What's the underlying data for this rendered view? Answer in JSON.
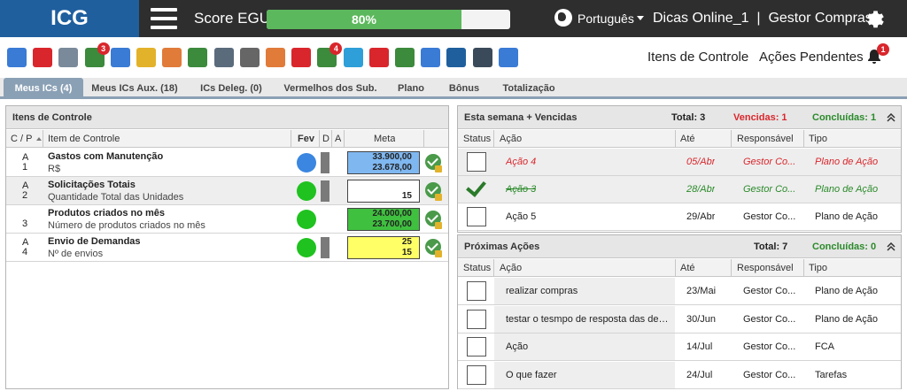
{
  "app": {
    "logo": "ICG",
    "score_label": "Score EGU:",
    "score_value": "80%",
    "score_fraction": 0.8,
    "language": "Português",
    "user": "Dicas Online_1  |  Gestor Compras"
  },
  "toolbar": {
    "icons": [
      {
        "name": "edit-icon",
        "color": "#3a7bd5"
      },
      {
        "name": "target-icon",
        "color": "#d9262c"
      },
      {
        "name": "checklist-icon",
        "color": "#7a8a9a"
      },
      {
        "name": "list-icon",
        "color": "#3c8a3c",
        "badge": "3"
      },
      {
        "name": "chart-down-icon",
        "color": "#3a7bd5"
      },
      {
        "name": "attachment-icon",
        "color": "#e3b22b"
      },
      {
        "name": "team-icon",
        "color": "#e07b39"
      },
      {
        "name": "award-icon",
        "color": "#3c8a3c"
      },
      {
        "name": "calendar-icon",
        "color": "#5a6b7c"
      },
      {
        "name": "stopwatch-icon",
        "color": "#666666"
      },
      {
        "name": "blocks-icon",
        "color": "#e07b39"
      },
      {
        "name": "crosshair-icon",
        "color": "#d9262c"
      },
      {
        "name": "approve-icon",
        "color": "#3c8a3c",
        "badge": "4"
      },
      {
        "name": "puzzle-icon",
        "color": "#2e9fd8"
      },
      {
        "name": "pdf-icon",
        "color": "#d9262c"
      },
      {
        "name": "alert-off-icon",
        "color": "#3c8a3c"
      },
      {
        "name": "presentation-icon",
        "color": "#3a7bd5"
      },
      {
        "name": "grid-icon",
        "color": "#1f5f9e"
      },
      {
        "name": "help-icon",
        "color": "#3a4a5a"
      },
      {
        "name": "rocket-icon",
        "color": "#3a7bd5"
      }
    ],
    "itens_label": "Itens de Controle",
    "acoes_label": "Ações Pendentes",
    "bell_badge": "1"
  },
  "tabs": [
    "Meus ICs (4)",
    "Meus ICs Aux. (18)",
    "ICs Deleg. (0)",
    "Vermelhos dos Sub.",
    "Plano",
    "Bônus",
    "Totalização"
  ],
  "left": {
    "title": "Itens de Controle",
    "headers": {
      "cp": "C / P",
      "item": "Item de Controle",
      "fev": "Fev",
      "d": "D",
      "a": "A",
      "meta": "Meta"
    },
    "rows": [
      {
        "c": "A",
        "p": "1",
        "name": "Gastos com Manutenção",
        "unit": "R$",
        "status": "blue",
        "meta": [
          "33.900,00",
          "23.678,00"
        ],
        "meta_color": "#7fb7f0"
      },
      {
        "c": "A",
        "p": "2",
        "name": "Solicitações Totais",
        "unit": "Quantidade Total das Unidades",
        "status": "green",
        "meta": [
          "",
          "15"
        ],
        "meta_color": "#ffffff"
      },
      {
        "c": "",
        "p": "3",
        "name": "Produtos criados no mês",
        "unit": "Número de produtos criados no mês",
        "status": "green",
        "meta": [
          "24.000,00",
          "23.700,00"
        ],
        "meta_color": "#3fc03f"
      },
      {
        "c": "A",
        "p": "4",
        "name": "Envio de Demandas",
        "unit": "Nº de envios",
        "status": "green",
        "meta": [
          "25",
          "15"
        ],
        "meta_color": "#ffff66"
      }
    ]
  },
  "right_top": {
    "title": "Esta semana + Vencidas",
    "total": "Total: 3",
    "vencidas": "Vencidas: 1",
    "concluidas": "Concluídas: 1",
    "headers": {
      "status": "Status",
      "acao": "Ação",
      "ate": "Até",
      "resp": "Responsável",
      "tipo": "Tipo"
    },
    "rows": [
      {
        "acao": "Ação 4",
        "ate": "05/Abr",
        "resp": "Gestor Co...",
        "tipo": "Plano de Ação",
        "state": "overdue"
      },
      {
        "acao": "Ação 3",
        "ate": "28/Abr",
        "resp": "Gestor Co...",
        "tipo": "Plano de Ação",
        "state": "done"
      },
      {
        "acao": "Ação 5",
        "ate": "29/Abr",
        "resp": "Gestor Co...",
        "tipo": "Plano de Ação",
        "state": "open"
      }
    ]
  },
  "right_bottom": {
    "title": "Próximas Ações",
    "total": "Total: 7",
    "concluidas": "Concluídas: 0",
    "headers": {
      "status": "Status",
      "acao": "Ação",
      "ate": "Até",
      "resp": "Responsável",
      "tipo": "Tipo"
    },
    "rows": [
      {
        "acao": "realizar compras",
        "ate": "23/Mai",
        "resp": "Gestor Co...",
        "tipo": "Plano de Ação"
      },
      {
        "acao": "testar o tesmpo de resposta das dema...",
        "ate": "30/Jun",
        "resp": "Gestor Co...",
        "tipo": "Plano de Ação"
      },
      {
        "acao": "Ação",
        "ate": "14/Jul",
        "resp": "Gestor Co...",
        "tipo": "FCA"
      },
      {
        "acao": "O que fazer",
        "ate": "24/Jul",
        "resp": "Gestor Co...",
        "tipo": "Tarefas"
      }
    ]
  }
}
